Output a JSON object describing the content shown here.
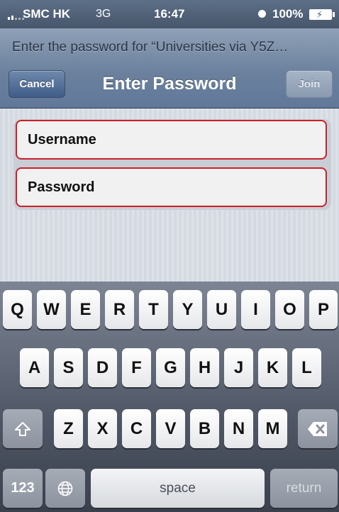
{
  "status_bar": {
    "carrier": "SMC HK",
    "network": "3G",
    "time": "16:47",
    "battery": "100%",
    "icons": [
      "signal-icon",
      "clock-icon",
      "battery-charging-icon"
    ]
  },
  "nav": {
    "prompt": "Enter the password for “Universities via Y5Z…",
    "title": "Enter Password",
    "cancel_label": "Cancel",
    "join_label": "Join"
  },
  "form": {
    "username_placeholder": "Username",
    "password_placeholder": "Password",
    "field_border_color": "#cc1f2a"
  },
  "keyboard": {
    "row1": [
      "Q",
      "W",
      "E",
      "R",
      "T",
      "Y",
      "U",
      "I",
      "O",
      "P"
    ],
    "row2": [
      "A",
      "S",
      "D",
      "F",
      "G",
      "H",
      "J",
      "K",
      "L"
    ],
    "row3": [
      "Z",
      "X",
      "C",
      "V",
      "B",
      "N",
      "M"
    ],
    "numbers_label": "123",
    "space_label": "space",
    "return_label": "return",
    "shift_icon": "shift-icon",
    "delete_icon": "delete-icon",
    "globe_icon": "globe-icon"
  }
}
